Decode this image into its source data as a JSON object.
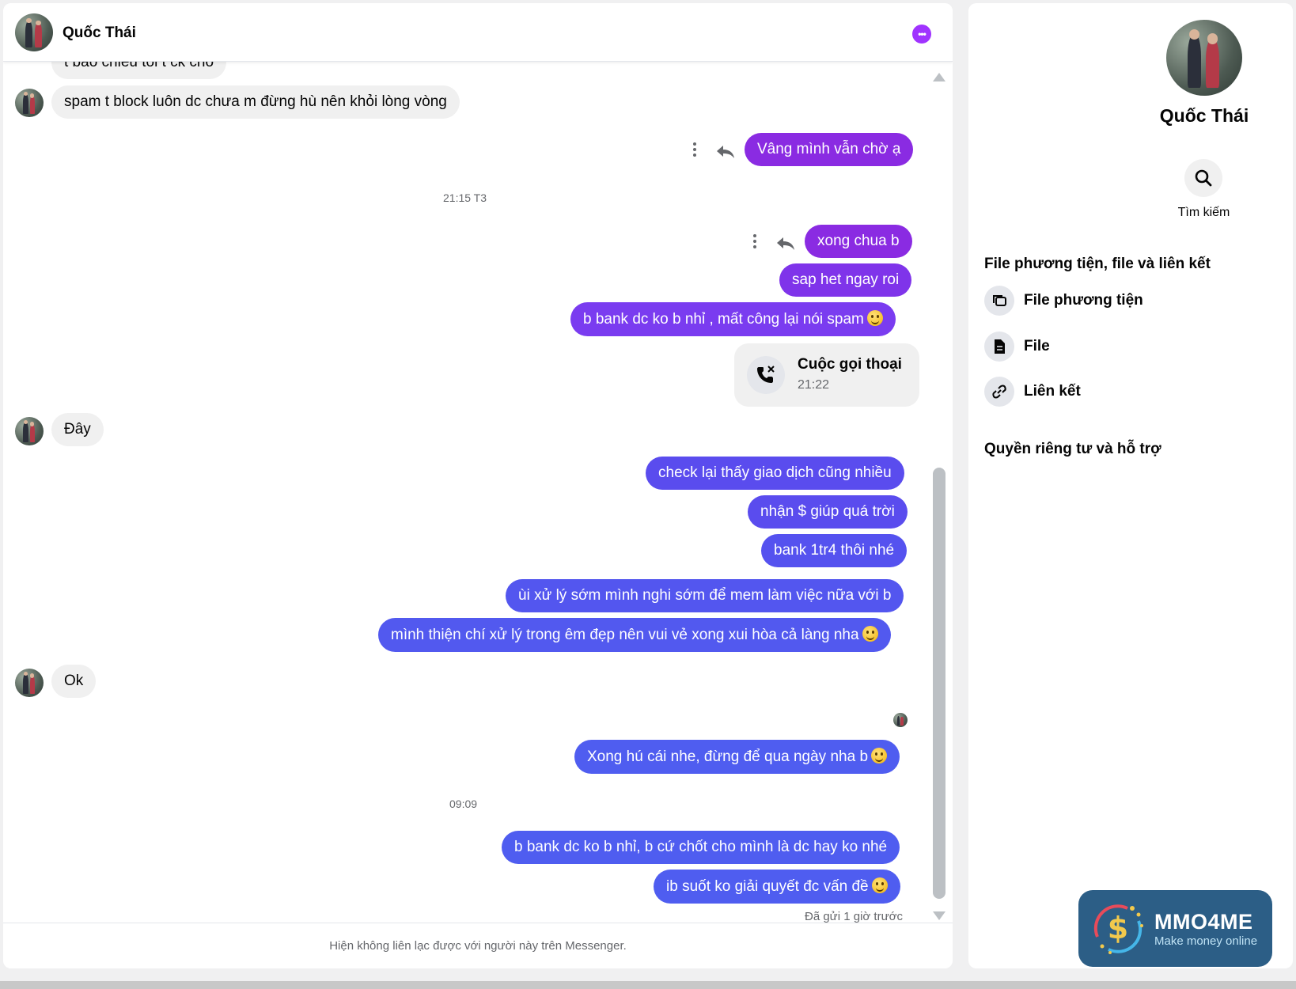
{
  "colors": {
    "purple": "#8a2be2",
    "violet": "#7a3cf0",
    "blue": "#4f5df0",
    "more_button": "#a033ff"
  },
  "header": {
    "name": "Quốc Thái",
    "more_icon": "more-icon"
  },
  "messages": {
    "m0": "t bảo chiều tối t ck cho",
    "m1": "spam t block luôn dc chưa m đừng hù nên khỏi lòng vòng",
    "m2": "Vâng mình vẫn chờ ạ",
    "ts1": "21:15 T3",
    "m3": "xong chua b",
    "m4": "sap het ngay roi",
    "m5": "b bank dc ko b nhỉ , mất công lại nói spam",
    "call_title": "Cuộc gọi thoại",
    "call_time": "21:22",
    "m6": "Đây",
    "m7": "check lại thấy giao dịch cũng nhiều",
    "m8": "nhận $ giúp quá trời",
    "m9": "bank 1tr4 thôi nhé",
    "m10": "ùi xử lý sớm mình nghi sớm để mem làm việc nữa với b",
    "m11": "mình thiện chí xử lý trong êm đẹp nên vui vẻ xong xui hòa cả làng nha",
    "m12": "Ok",
    "m13": "Xong hú cái nhe, đừng để qua ngày nha b",
    "ts2": "09:09",
    "m14": "b bank dc ko b nhỉ, b cứ chốt cho mình là dc hay ko nhé",
    "m15": "ib suốt ko giải quyết đc vấn đề",
    "sent_status": "Đã gửi 1 giờ trước"
  },
  "footer": {
    "notice": "Hiện không liên lạc được với người này trên Messenger."
  },
  "info": {
    "name": "Quốc Thái",
    "search_label": "Tìm kiếm",
    "section_media": "File phương tiện, file và liên kết",
    "media_item": "File phương tiện",
    "file_item": "File",
    "link_item": "Liên kết",
    "section_privacy": "Quyền riêng tư và hỗ trợ"
  },
  "brand": {
    "title": "MMO4ME",
    "subtitle": "Make money online"
  }
}
